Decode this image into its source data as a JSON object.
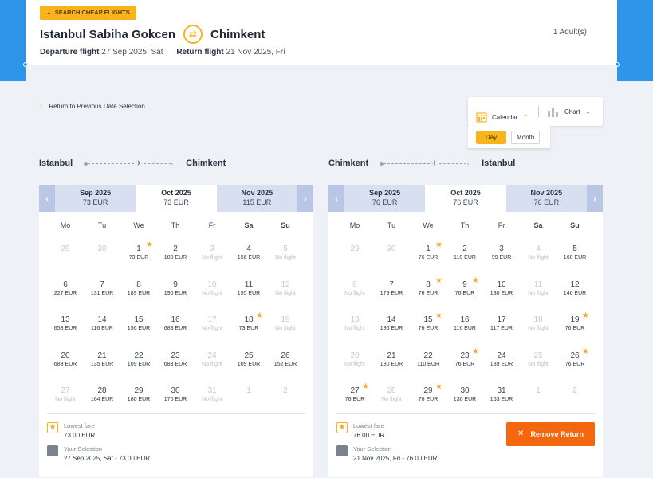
{
  "badge": "SEARCH CHEAP FLIGHTS",
  "route": {
    "from": "Istanbul Sabiha Gokcen",
    "to": "Chimkent"
  },
  "adults": "1 Adult(s)",
  "dates": {
    "departure_label": "Departure flight",
    "departure_value": "27 Sep 2025, Sat",
    "return_label": "Return flight",
    "return_value": "21 Nov 2025, Fri"
  },
  "back_link": "Return to Previous Date Selection",
  "view_toggle": {
    "calendar": "Calendar",
    "chart": "Chart",
    "day": "Day",
    "month": "Month"
  },
  "weekdays": [
    "Mo",
    "Tu",
    "We",
    "Th",
    "Fr",
    "Sa",
    "Su"
  ],
  "outbound": {
    "from": "Istanbul",
    "to": "Chimkent",
    "months": [
      {
        "name": "Sep 2025",
        "price": "73 EUR"
      },
      {
        "name": "Oct 2025",
        "price": "73 EUR"
      },
      {
        "name": "Nov 2025",
        "price": "115 EUR"
      }
    ],
    "days": [
      {
        "d": "29",
        "p": "",
        "muted": true
      },
      {
        "d": "30",
        "p": "",
        "muted": true
      },
      {
        "d": "1",
        "p": "73 EUR",
        "star": true
      },
      {
        "d": "2",
        "p": "180 EUR"
      },
      {
        "d": "3",
        "p": "No flight",
        "nof": true
      },
      {
        "d": "4",
        "p": "156 EUR"
      },
      {
        "d": "5",
        "p": "No flight",
        "nof": true
      },
      {
        "d": "6",
        "p": "227 EUR"
      },
      {
        "d": "7",
        "p": "131 EUR"
      },
      {
        "d": "8",
        "p": "189 EUR"
      },
      {
        "d": "9",
        "p": "190 EUR"
      },
      {
        "d": "10",
        "p": "No flight",
        "nof": true
      },
      {
        "d": "11",
        "p": "155 EUR"
      },
      {
        "d": "12",
        "p": "No flight",
        "nof": true
      },
      {
        "d": "13",
        "p": "658 EUR"
      },
      {
        "d": "14",
        "p": "116 EUR"
      },
      {
        "d": "15",
        "p": "156 EUR"
      },
      {
        "d": "16",
        "p": "683 EUR"
      },
      {
        "d": "17",
        "p": "No flight",
        "nof": true
      },
      {
        "d": "18",
        "p": "73 EUR",
        "star": true
      },
      {
        "d": "19",
        "p": "No flight",
        "nof": true
      },
      {
        "d": "20",
        "p": "683 EUR"
      },
      {
        "d": "21",
        "p": "135 EUR"
      },
      {
        "d": "22",
        "p": "109 EUR"
      },
      {
        "d": "23",
        "p": "683 EUR"
      },
      {
        "d": "24",
        "p": "No flight",
        "nof": true
      },
      {
        "d": "25",
        "p": "109 EUR"
      },
      {
        "d": "26",
        "p": "152 EUR"
      },
      {
        "d": "27",
        "p": "No flight",
        "nof": true
      },
      {
        "d": "28",
        "p": "164 EUR"
      },
      {
        "d": "29",
        "p": "180 EUR"
      },
      {
        "d": "30",
        "p": "170 EUR"
      },
      {
        "d": "31",
        "p": "No flight",
        "nof": true
      },
      {
        "d": "1",
        "p": "",
        "muted": true
      },
      {
        "d": "2",
        "p": "",
        "muted": true
      }
    ],
    "legend": {
      "lowest_label": "Lowest fare",
      "lowest_value": "73.00 EUR",
      "selection_label": "Your Selection",
      "selection_value": "27 Sep 2025, Sat - 73.00 EUR"
    }
  },
  "inbound": {
    "from": "Chimkent",
    "to": "Istanbul",
    "months": [
      {
        "name": "Sep 2025",
        "price": "76 EUR"
      },
      {
        "name": "Oct 2025",
        "price": "76 EUR"
      },
      {
        "name": "Nov 2025",
        "price": "76 EUR"
      }
    ],
    "days": [
      {
        "d": "29",
        "p": "",
        "muted": true
      },
      {
        "d": "30",
        "p": "",
        "muted": true
      },
      {
        "d": "1",
        "p": "76 EUR",
        "star": true
      },
      {
        "d": "2",
        "p": "110 EUR"
      },
      {
        "d": "3",
        "p": "99 EUR"
      },
      {
        "d": "4",
        "p": "No flight",
        "nof": true
      },
      {
        "d": "5",
        "p": "160 EUR"
      },
      {
        "d": "6",
        "p": "No flight",
        "nof": true
      },
      {
        "d": "7",
        "p": "179 EUR"
      },
      {
        "d": "8",
        "p": "76 EUR",
        "star": true
      },
      {
        "d": "9",
        "p": "76 EUR",
        "star": true
      },
      {
        "d": "10",
        "p": "130 EUR"
      },
      {
        "d": "11",
        "p": "No flight",
        "nof": true
      },
      {
        "d": "12",
        "p": "146 EUR"
      },
      {
        "d": "13",
        "p": "No flight",
        "nof": true
      },
      {
        "d": "14",
        "p": "196 EUR"
      },
      {
        "d": "15",
        "p": "76 EUR",
        "star": true
      },
      {
        "d": "16",
        "p": "116 EUR"
      },
      {
        "d": "17",
        "p": "117 EUR"
      },
      {
        "d": "18",
        "p": "No flight",
        "nof": true
      },
      {
        "d": "19",
        "p": "76 EUR",
        "star": true
      },
      {
        "d": "20",
        "p": "No flight",
        "nof": true
      },
      {
        "d": "21",
        "p": "130 EUR"
      },
      {
        "d": "22",
        "p": "110 EUR"
      },
      {
        "d": "23",
        "p": "76 EUR",
        "star": true
      },
      {
        "d": "24",
        "p": "139 EUR"
      },
      {
        "d": "25",
        "p": "No flight",
        "nof": true
      },
      {
        "d": "26",
        "p": "76 EUR",
        "star": true
      },
      {
        "d": "27",
        "p": "76 EUR",
        "star": true
      },
      {
        "d": "28",
        "p": "No flight",
        "nof": true
      },
      {
        "d": "29",
        "p": "76 EUR",
        "star": true
      },
      {
        "d": "30",
        "p": "130 EUR"
      },
      {
        "d": "31",
        "p": "163 EUR"
      },
      {
        "d": "1",
        "p": "",
        "muted": true
      },
      {
        "d": "2",
        "p": "",
        "muted": true
      }
    ],
    "legend": {
      "lowest_label": "Lowest fare",
      "lowest_value": "76.00 EUR",
      "selection_label": "Your Selection",
      "selection_value": "21 Nov 2025, Fri - 76.00 EUR"
    },
    "remove_label": "Remove Return"
  },
  "colors": {
    "accent": "#f9b31c",
    "brand_blue": "#2f95e9",
    "remove": "#f4670e",
    "month_bar": "#d7dff0"
  }
}
